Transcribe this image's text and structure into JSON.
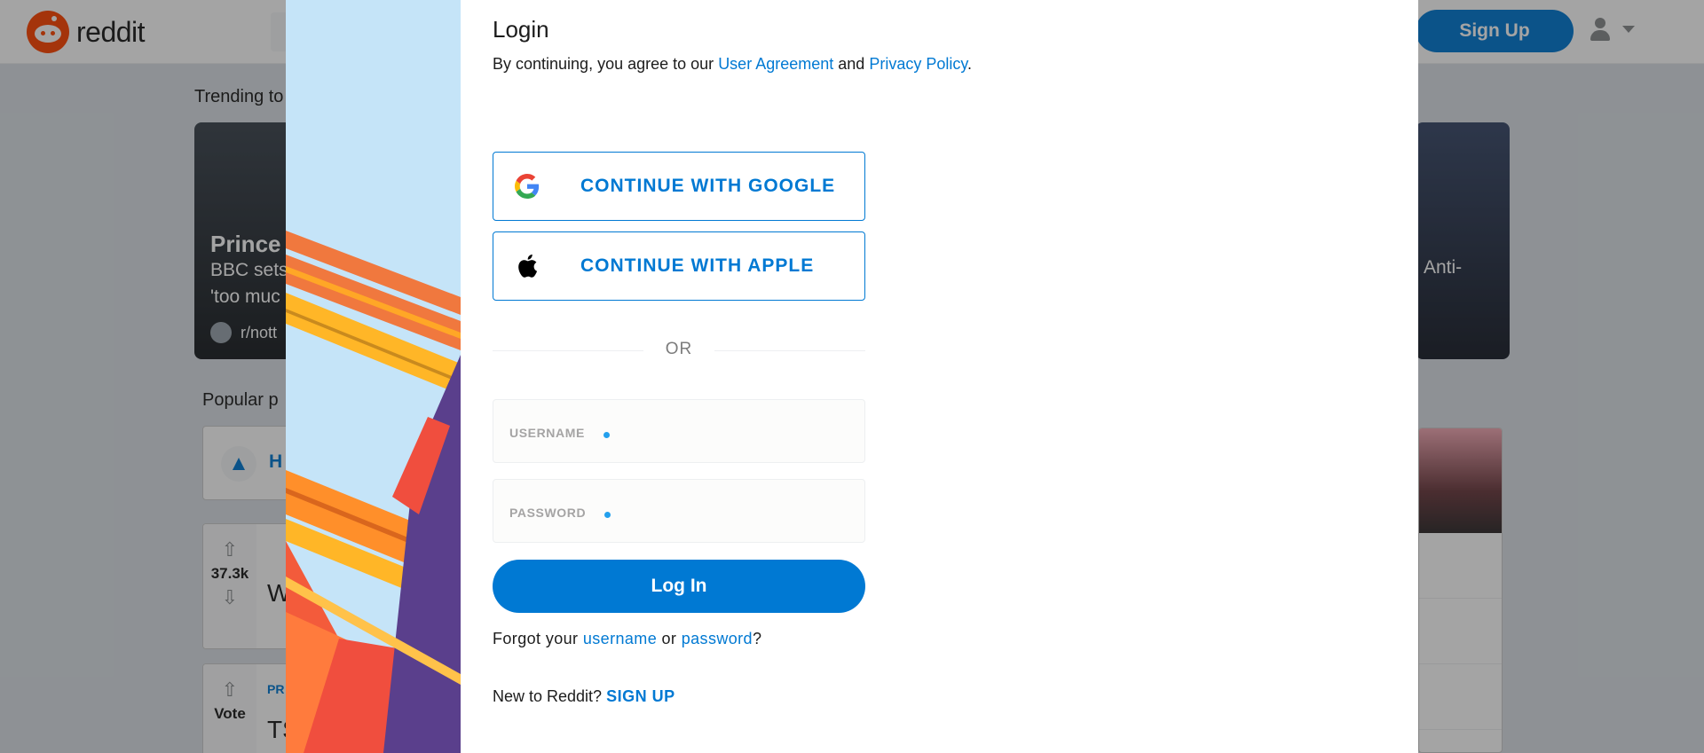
{
  "header": {
    "logo_text": "reddit",
    "signup_label": "Sign Up"
  },
  "background": {
    "trending_title": "Trending to",
    "trend_left": {
      "headline": "Prince",
      "sub_line1": "BBC sets",
      "sub_line2": "'too muc",
      "community": "r/nott"
    },
    "trend_right": {
      "sub": "Anti-"
    },
    "popular_title": "Popular p",
    "sort_hot": "H",
    "post1": {
      "votes": "37.3k",
      "title": "W"
    },
    "post2": {
      "votes": "Vote",
      "flair": "PR",
      "title": "TS"
    }
  },
  "modal": {
    "title": "Login",
    "agreement_prefix": "By continuing, you agree to our",
    "user_agreement": "User Agreement",
    "and": "and",
    "privacy_policy": "Privacy Policy",
    "period": ".",
    "google_label": "CONTINUE WITH GOOGLE",
    "apple_label": "CONTINUE WITH APPLE",
    "or_label": "OR",
    "username_label": "USERNAME",
    "password_label": "PASSWORD",
    "login_label": "Log In",
    "forgot_prefix": "Forgot your",
    "forgot_username": "username",
    "forgot_or": "or",
    "forgot_password": "password",
    "forgot_suffix": "?",
    "new_prefix": "New to Reddit?",
    "signup_link": "SIGN UP"
  },
  "colors": {
    "brand_blue": "#0079d3",
    "reddit_orange": "#ff4500",
    "art_background": "#c5e4f8"
  }
}
